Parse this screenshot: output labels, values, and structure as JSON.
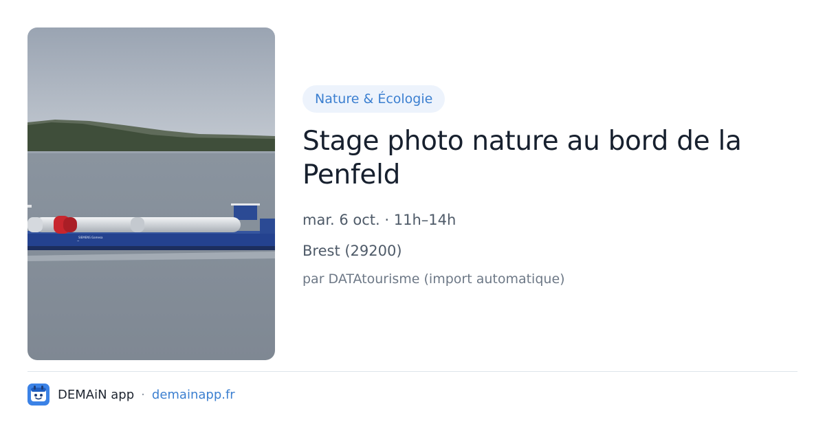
{
  "event": {
    "category": "Nature & Écologie",
    "title": "Stage photo nature au bord de la Penfeld",
    "datetime": "mar. 6 oct. · 11h–14h",
    "location": "Brest (29200)",
    "source": "par DATAtourisme (import automatique)"
  },
  "photo": {
    "subject": "cargo ship carrying wind turbine blades on the sea",
    "ship_labels": [
      "SIEMENS Gamesa"
    ]
  },
  "footer": {
    "app_name": "DEMAiN app",
    "separator": "·",
    "app_url": "demainapp.fr",
    "icon": "app-logo-icon"
  },
  "colors": {
    "accent": "#3b7fd0",
    "category_bg": "#edf3fc",
    "title": "#17202e",
    "meta": "#4e5a68"
  }
}
